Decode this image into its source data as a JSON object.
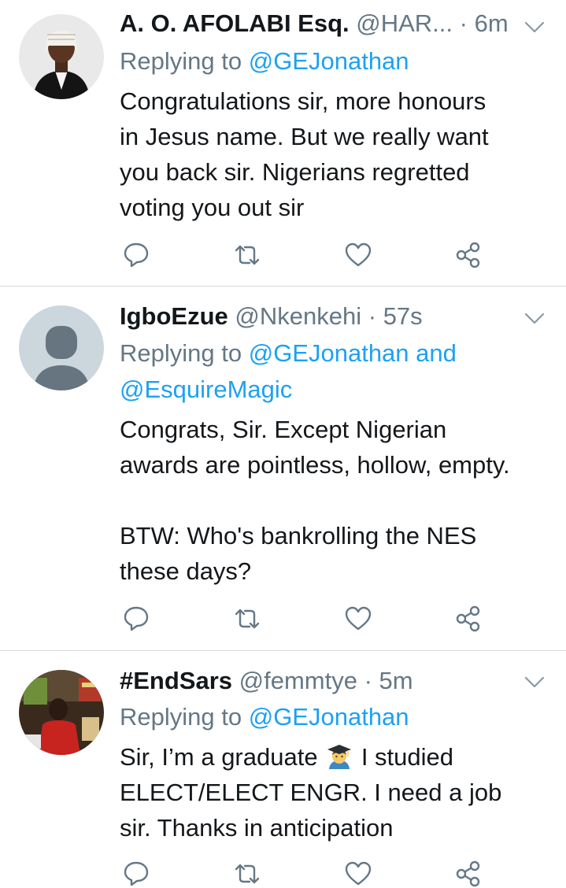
{
  "tweets": [
    {
      "name": "A. O. AFOLABI Esq.",
      "handle": "@HAR...",
      "time": "6m",
      "reply_prefix": "Replying to ",
      "reply_to": "@GEJonathan",
      "text_lines": [
        "Congratulations sir, more honours",
        "in Jesus name. But we really want",
        "you back sir. Nigerians regretted",
        "voting you out sir"
      ],
      "avatar": "judge-wig-photo"
    },
    {
      "name": "IgboEzue",
      "handle": "@Nkenkehi",
      "time": "57s",
      "reply_prefix": "Replying to ",
      "reply_to": "@GEJonathan and",
      "reply_to_2": "@EsquireMagic",
      "text_lines": [
        "Congrats, Sir. Except Nigerian",
        "awards are pointless, hollow, empty."
      ],
      "text_lines_2": [
        "BTW: Who's bankrolling the NES",
        "these days?"
      ],
      "avatar": "default-profile"
    },
    {
      "name": "#EndSars",
      "handle": "@femmtye",
      "time": "5m",
      "reply_prefix": "Replying to ",
      "reply_to": "@GEJonathan",
      "text_line_1a": "Sir, I’m a graduate",
      "text_line_1b": "I studied",
      "text_lines_rest": [
        "ELECT/ELECT ENGR. I need a job",
        "sir. Thanks in anticipation"
      ],
      "emoji": "man-graduate-emoji",
      "avatar": "poster-photo"
    }
  ],
  "icons": {
    "reply": "reply-icon",
    "retweet": "retweet-icon",
    "like": "like-icon",
    "share": "share-icon",
    "more": "chevron-down-icon"
  },
  "colors": {
    "link": "#1da1f2",
    "meta": "#657786",
    "text": "#14171a",
    "divider": "#d4d9dd"
  }
}
